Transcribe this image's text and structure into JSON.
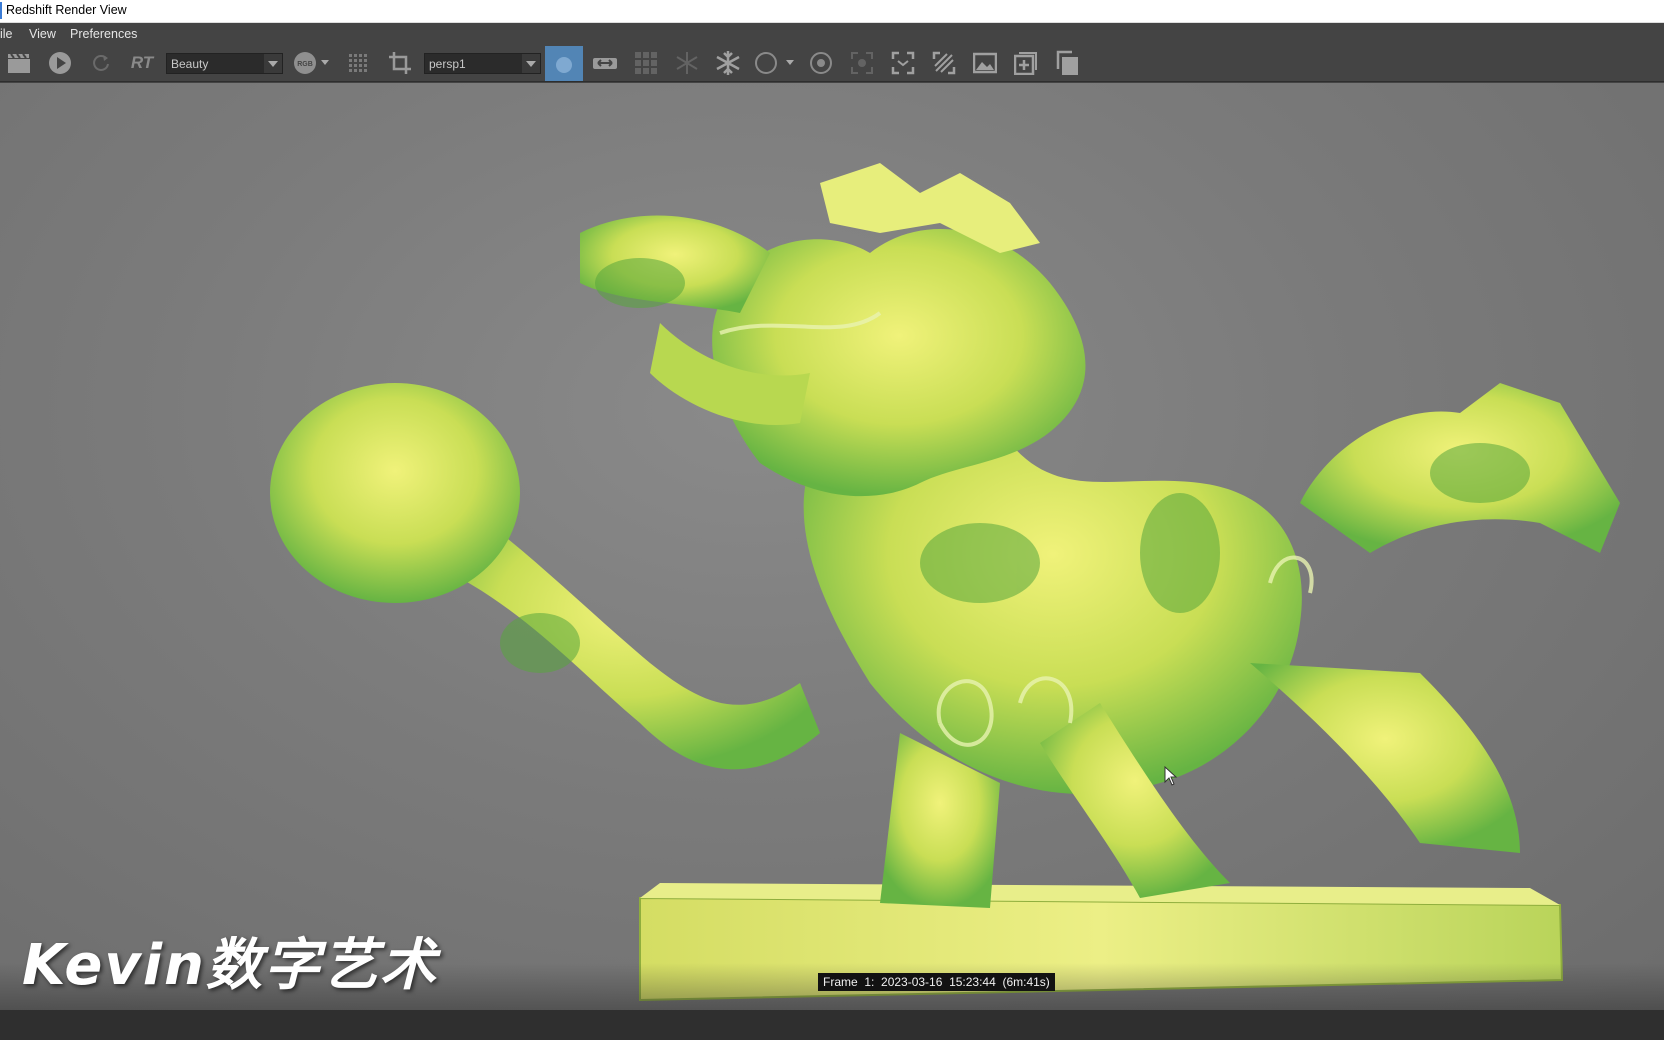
{
  "window": {
    "title": "Redshift Render View"
  },
  "menu": {
    "items": [
      "ile",
      "View",
      "Preferences"
    ]
  },
  "toolbar": {
    "rt_label": "RT",
    "aov_select": {
      "value": "Beauty"
    },
    "channel_badge": "RGB",
    "camera_select": {
      "value": "persp1"
    },
    "active_color": "#5285b5"
  },
  "viewport": {
    "subject": "jade dragon sculpture render",
    "background_color": "#7b7b7b"
  },
  "status": {
    "frame_info": "Frame  1:  2023-03-16  15:23:44  (6m:41s)"
  },
  "watermark": {
    "text": "Kevin数字艺术"
  },
  "icons": [
    "clapper-icon",
    "play-icon",
    "refresh-icon",
    "rgb-icon",
    "grid-icon",
    "crop-icon",
    "sphere-icon",
    "camera-icon",
    "checker-icon",
    "snowflake-icon",
    "snowflake-bold-icon",
    "circle-icon",
    "focus-icon",
    "region-icon",
    "fit-icon",
    "hatch-icon",
    "image-icon",
    "add-icon",
    "copy-icon"
  ]
}
